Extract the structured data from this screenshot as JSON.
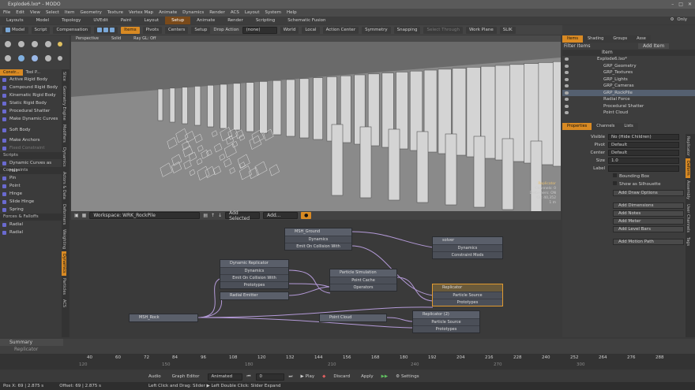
{
  "window": {
    "title": "Explode6.lxo* - MODO"
  },
  "menu": [
    "File",
    "Edit",
    "View",
    "Select",
    "Item",
    "Geometry",
    "Texture",
    "Vertex Map",
    "Animate",
    "Dynamics",
    "Render",
    "ACS",
    "Layout",
    "System",
    "Help"
  ],
  "layout_tabs": [
    {
      "label": "Layouts"
    },
    {
      "label": "Model"
    },
    {
      "label": "Topology"
    },
    {
      "label": "UVEdit"
    },
    {
      "label": "Paint"
    },
    {
      "label": "Layout"
    },
    {
      "label": "Setup",
      "active": true
    },
    {
      "label": "Animate"
    },
    {
      "label": "Render"
    },
    {
      "label": "Scripting"
    },
    {
      "label": "Schematic Fusion"
    }
  ],
  "top_right": {
    "only_label": "Only"
  },
  "toolbar": {
    "model": "Model",
    "script": "Script",
    "compensation": "Compensation",
    "items": "Items",
    "pivots": "Pivots",
    "centers": "Centers",
    "setup": "Setup",
    "drop_action_label": "Drop Action",
    "drop_action_value": "(none)",
    "world": "World",
    "local": "Local",
    "action_center": "Action Center",
    "symmetry": "Symmetry",
    "snapping": "Snapping",
    "select_through": "Select Through",
    "work_plane": "Work Plane",
    "slik": "SLIK"
  },
  "left_panel": {
    "tabs": [
      "Constr...",
      "Tool P..."
    ],
    "rigid": [
      "Active Rigid Body",
      "Compound Rigid Body",
      "Kinematic Rigid Body",
      "Static Rigid Body",
      "Procedural Shatter",
      "Make Dynamic Curves"
    ],
    "soft": "Soft Body",
    "anchor": [
      "Make Anchors",
      "Fixed Constraint"
    ],
    "scripts_section": "Scripts",
    "scripts": [
      "Dynamic Curves as Hair"
    ],
    "constraints_section": "Constraints",
    "constraints": [
      "Pin",
      "Point",
      "Hinge",
      "Slide Hinge",
      "Spring"
    ],
    "forces_section": "Forces & Falloffs",
    "forces": [
      "Radial",
      "Radial"
    ],
    "vtabs": [
      "Slice",
      "Geometry Engine",
      "Modifiers",
      "Dynamics",
      "Actors & Data",
      "Deformers",
      "Weighting",
      "Dynamics",
      "Particles",
      "ACS"
    ]
  },
  "viewport": {
    "head": [
      "Perspective",
      "Solid",
      "Ray GL: Off"
    ],
    "overlay": [
      "Replicator",
      "Channels: 0",
      "Deformers: ON",
      "GL: 40,352",
      "1 m"
    ]
  },
  "schematic": {
    "workspace": "Workspace: WRK_RockPile",
    "add_selected": "Add Selected",
    "add": "Add...",
    "nodes": {
      "msh_ground": {
        "title": "MSH_Ground",
        "rows": [
          "Dynamics",
          "Emit On Collision With"
        ]
      },
      "solver": {
        "title": "solver",
        "rows": [
          "Dynamics",
          "Constraint Mods"
        ]
      },
      "dyn_rep": {
        "title": "Dynamic Replicator",
        "rows": [
          "Dynamics",
          "Emit On Collision With",
          "Prototypes"
        ]
      },
      "particle_sim": {
        "title": "Particle Simulation",
        "rows": [
          "Point Cache",
          "Operators"
        ]
      },
      "radial_emitter": {
        "title": "Radial Emitter",
        "rows": []
      },
      "replicator": {
        "title": "Replicator",
        "rows": [
          "Particle Source",
          "Prototypes"
        ]
      },
      "msh_rock": {
        "title": "MSH_Rock",
        "rows": []
      },
      "point_cloud": {
        "title": "Point Cloud",
        "rows": []
      },
      "replicator2": {
        "title": "Replicator (2)",
        "rows": [
          "Particle Source",
          "Prototypes"
        ]
      }
    }
  },
  "items_panel": {
    "tabs": [
      "Items",
      "Shading",
      "Groups",
      "Asse"
    ],
    "filter": "Filter Items",
    "add_item": "Add Item",
    "column": "Item",
    "tree": [
      {
        "label": "Explode6.lxo*",
        "indent": 0
      },
      {
        "label": "GRP_Geometry",
        "indent": 1
      },
      {
        "label": "GRP_Textures",
        "indent": 1
      },
      {
        "label": "GRP_Lights",
        "indent": 1
      },
      {
        "label": "GRP_Cameras",
        "indent": 1
      },
      {
        "label": "GRP_RockPile",
        "indent": 1
      },
      {
        "label": "Radial Force",
        "indent": 1
      },
      {
        "label": "Procedural Shatter",
        "indent": 1
      },
      {
        "label": "Point Cloud",
        "indent": 1
      }
    ]
  },
  "properties": {
    "tabs": [
      "Properties",
      "Channels",
      "Lists"
    ],
    "fields": [
      {
        "k": "Visible",
        "v": "No (Hide Children)"
      },
      {
        "k": "Pivot",
        "v": "Default"
      },
      {
        "k": "Center",
        "v": "Default"
      },
      {
        "k": "Size",
        "v": "1.0"
      },
      {
        "k": "Label",
        "v": ""
      }
    ],
    "checks": [
      "Bounding Box",
      "Show as Silhouette"
    ],
    "buttons": [
      "Add Draw Options",
      "Add Dimensions",
      "Add Notes",
      "Add Meter",
      "Add Level Bars",
      "Add Motion Path"
    ],
    "vtabs": [
      "Replicator",
      "Deform",
      "Assembly",
      "User Channels",
      "Tags"
    ]
  },
  "timeline": {
    "summary": "Summary",
    "track": "Replicator",
    "ticks": [
      "40",
      "60",
      "72",
      "84",
      "96",
      "108",
      "120",
      "132",
      "144",
      "156",
      "168",
      "180",
      "192",
      "204",
      "216",
      "228",
      "240",
      "252",
      "264",
      "276",
      "288"
    ],
    "frames": [
      "120",
      "150",
      "180",
      "210",
      "240",
      "270",
      "300"
    ]
  },
  "bottom": {
    "audio": "Audio",
    "graph_editor": "Graph Editor",
    "animated": "Animated",
    "frame": "0",
    "play": "Play",
    "discard": "Discard",
    "apply": "Apply",
    "settings": "Settings"
  },
  "status": {
    "pos": "Pos X: 69 | 2.875 s",
    "offset": "Offset: 69 | 2.875 s",
    "hint": "Left Click and Drag: Slider  ▶  Left Double Click: Slider Expand"
  }
}
